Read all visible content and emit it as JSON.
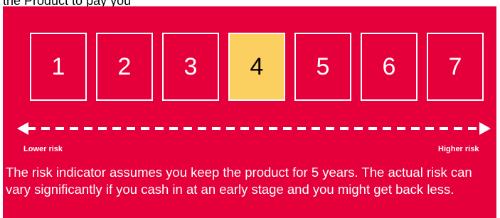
{
  "intro_line": "the Product to pay you",
  "scale": {
    "values": [
      "1",
      "2",
      "3",
      "4",
      "5",
      "6",
      "7"
    ],
    "selected": "4",
    "colors": {
      "background": "#e5003b",
      "selected_fill": "#fcd060",
      "border": "#ffffff"
    }
  },
  "axis": {
    "low_label": "Lower risk",
    "high_label": "Higher risk"
  },
  "note": "The risk indicator assumes you keep the product for 5 years. The actual risk can vary significantly if you cash in at an early stage and you might get back less."
}
